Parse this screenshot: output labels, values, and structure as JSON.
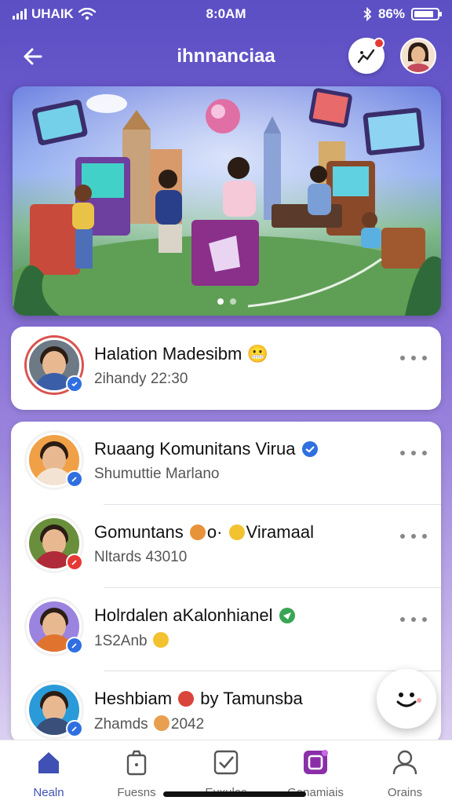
{
  "status_bar": {
    "carrier": "UHAIK",
    "time": "8:0AM",
    "battery": "86%",
    "battery_level": 0.86
  },
  "header": {
    "title": "ihnnanciaa",
    "back_icon": "arrow-left-icon",
    "activity_icon": "chart-badge-icon",
    "profile_icon": "user-avatar"
  },
  "banner": {
    "slides": 2,
    "active_slide": 0
  },
  "featured": {
    "title": "Halation Madesibm",
    "emoji": "😬",
    "subtitle": "2ihandy 22:30",
    "badge_color": "#2f6fe0",
    "ring_color": "#d9534f"
  },
  "list": [
    {
      "title": "Ruaang Komunitans Virua",
      "title_icon": "verified-icon",
      "subtitle": "Shumuttie Marlano",
      "badge_color": "#2f6fe0",
      "ring_color": "#f08a24"
    },
    {
      "title_a": "Gomuntans",
      "title_b": "o·",
      "title_c": "Viramaal",
      "subtitle": "Nltards 43010",
      "badge_color": "#e53935",
      "ring_color": "#6a8f3c"
    },
    {
      "title": "Holrdalen aKalonhianel",
      "title_icon": "send-icon",
      "subtitle": "1S2Anb",
      "badge_color": "#2f6fe0",
      "ring_color": "#7d5fd6"
    },
    {
      "title_a": "Heshbiam",
      "title_c": "by Tamunsba",
      "subtitle": "Zhamds",
      "subtitle_b": "2042",
      "badge_color": "#2f6fe0",
      "ring_color": "#2a9ad8"
    }
  ],
  "fab": {
    "icon": "smiley-icon"
  },
  "bottom_nav": [
    {
      "label": "Nealn",
      "icon": "home-icon",
      "active": true
    },
    {
      "label": "Fuesns",
      "icon": "bag-icon",
      "active": false
    },
    {
      "label": "Euxulas",
      "icon": "checkbox-icon",
      "active": false
    },
    {
      "label": "Ganamiais",
      "icon": "game-icon",
      "active": false
    },
    {
      "label": "Orains",
      "icon": "profile-icon",
      "active": false
    }
  ],
  "colors": {
    "accent": "#3f51b5",
    "background": "#7a63d2"
  }
}
